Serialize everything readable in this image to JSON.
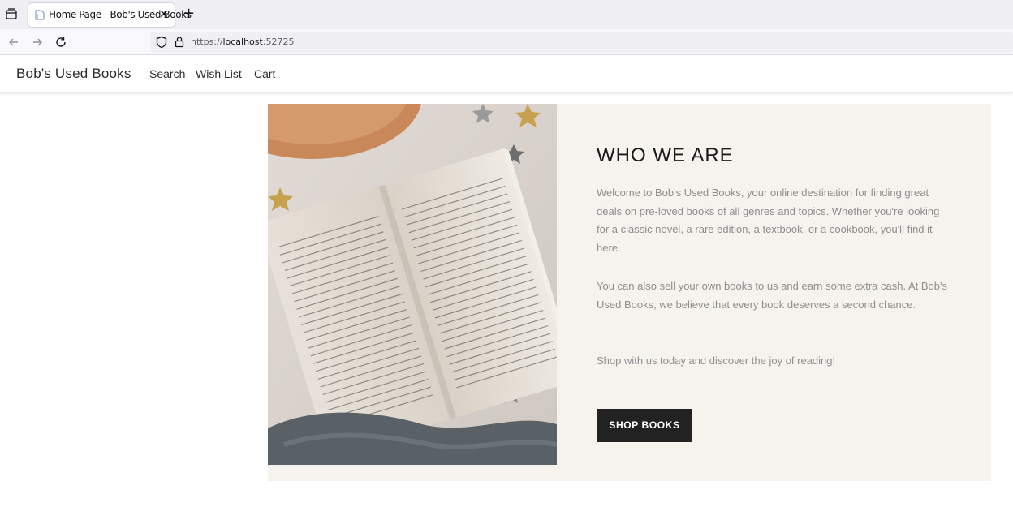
{
  "browser": {
    "tab_title": "Home Page - Bob's Used Books",
    "tab_close": "✕",
    "new_tab": "+",
    "url_prefix": "https://",
    "url_host": "localhost",
    "url_port": ":52725",
    "icons": [
      "tabs-list-icon",
      "back-arrow-icon",
      "forward-arrow-icon",
      "reload-icon",
      "shield-icon",
      "lock-icon",
      "page-favicon-icon",
      "close-icon",
      "plus-icon"
    ]
  },
  "site": {
    "brand": "Bob's Used Books",
    "nav": [
      {
        "label": "Search"
      },
      {
        "label": "Wish List"
      },
      {
        "label": "Cart"
      }
    ]
  },
  "hero": {
    "title": "WHO WE ARE",
    "paragraph1": "Welcome to Bob's Used Books, your online destination for finding great deals on pre-loved books of all genres and topics. Whether you're looking for a classic novel, a rare edition, a textbook, or a cookbook, you'll find it here.",
    "paragraph2": "You can also sell your own books to us and earn some extra cash. At Bob's Used Books, we believe that every book deserves a second chance.",
    "paragraph3": "Shop with us today and discover the joy of reading!",
    "button": "SHOP BOOKS",
    "image": "open-book-photo"
  },
  "colors": {
    "panel_bg": "#f6f3ef",
    "button_bg": "#222222",
    "text_muted": "#8d8d8d"
  }
}
